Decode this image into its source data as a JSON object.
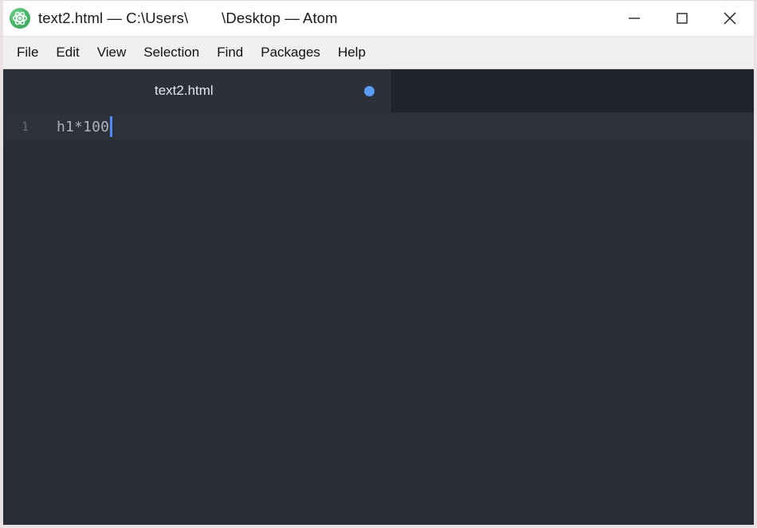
{
  "window": {
    "title": "text2.html — C:\\Users\\        \\Desktop — Atom",
    "app_icon_name": "atom-logo-icon",
    "controls": {
      "minimize_label": "Minimize",
      "maximize_label": "Maximize",
      "close_label": "Close"
    }
  },
  "menubar": {
    "items": [
      {
        "label": "File"
      },
      {
        "label": "Edit"
      },
      {
        "label": "View"
      },
      {
        "label": "Selection"
      },
      {
        "label": "Find"
      },
      {
        "label": "Packages"
      },
      {
        "label": "Help"
      }
    ]
  },
  "tabs": [
    {
      "label": "text2.html",
      "modified": true,
      "active": true
    }
  ],
  "editor": {
    "lines": [
      {
        "number": "1",
        "text": "h1*100"
      }
    ],
    "cursor": {
      "line": 1,
      "column": 7
    }
  },
  "colors": {
    "titlebar_bg": "#ffffff",
    "menubar_bg": "#f0f0f0",
    "tabbar_bg": "#21252b",
    "active_tab_bg": "#2b303b",
    "editor_bg": "#282c34",
    "active_line_bg": "#2c313a",
    "code_text": "#abb2bf",
    "gutter_text": "#636d7e",
    "cursor": "#528bff",
    "modified_dot": "#5a9cf8",
    "atom_green": "#3eb168"
  }
}
